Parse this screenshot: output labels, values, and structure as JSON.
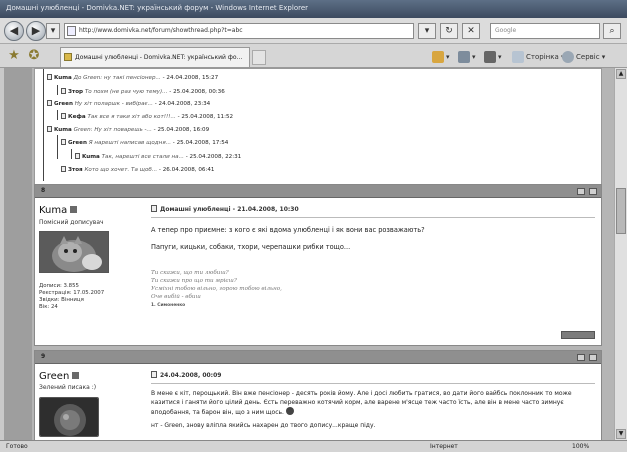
{
  "window": {
    "title": "Домашні улюбленці - Domivka.NET: український форум - Windows Internet Explorer"
  },
  "address_bar": {
    "url": "http://www.domivka.net/forum/showthread.php?t=abc",
    "search_placeholder": "Google"
  },
  "tab": {
    "label": "Домашні улюбленці - Domivka.NET: український фо..."
  },
  "toolbar": {
    "page_label": "Сторінка",
    "tools_label": "Сервіс"
  },
  "thread_tree": [
    {
      "author": "Kuma",
      "title": "До Green: ну такі пенсіонер...",
      "date": "24.04.2008, 15:27"
    },
    {
      "author": "Зтор",
      "title": "То похм (не раз чую тему)...",
      "date": "25.04.2008, 00:36"
    },
    {
      "author": "Green",
      "title": "Ну хіт поларшк - вибірає...",
      "date": "24.04.2008, 23:34"
    },
    {
      "author": "Кефа",
      "title": "Так все я таки хіт або кот!!!...",
      "date": "25.04.2008, 11:52"
    },
    {
      "author": "Kuma",
      "title": "Green: Ну хіт поварешь -...",
      "date": "25.04.2008, 16:09"
    },
    {
      "author": "Green",
      "title": "Я нарешті написав щодня...",
      "date": "25.04.2008, 17:54"
    },
    {
      "author": "Kuma",
      "title": "Так, нарешті все стали на...",
      "date": "25.04.2008, 22:31"
    },
    {
      "author": "Зтоя",
      "title": "Кото що хочет. Та щоб...",
      "date": "26.04.2008, 06:41"
    }
  ],
  "posts": [
    {
      "number": "8",
      "username": "Kuma",
      "user_title": "Помісний дописувач",
      "user_info": [
        "Дописи: 3.855",
        "Реєстрація: 17.05.2007",
        "Звідки: Вінниця",
        "Вік: 24"
      ],
      "title": "Домашні улюбленці - 21.04.2008, 10:30",
      "body": [
        "А тепер про приємне: з кого є які вдома улюбленці і як вони вас розважають?",
        "Папуги, кицьки, собаки, тхори, черепашки рибки тощо..."
      ],
      "signature": [
        "Ти скажи, що ти любиш?",
        "Ти скажи про що ти мрієш?",
        "Усміхні тобою вільно, горою тобою вільно,",
        "Оче вибій - вбиш"
      ],
      "signature_small": "1. Симоненко"
    },
    {
      "number": "9",
      "username": "Green",
      "user_title": "Зелений писака :)",
      "title": "24.04.2008, 00:09",
      "body": [
        "В мене є кіт, перощький. Він вже пенсіонер - десять років йому. Але і досі любить гратися, во дати його вайбсь поклонник то може казитися і ганяти його цілий день. Єсть переважно котячий корм, але варене м'ясце теж часто їсть, але він в мене часто зимнує вподобання, та барон він, що з ним щось.",
        "нт - Green, знову вліпла якийсь нахарен до твого допису...краще піду."
      ]
    }
  ],
  "status_bar": {
    "left": "Готово",
    "zone": "Інтернет",
    "zoom": "100%"
  }
}
